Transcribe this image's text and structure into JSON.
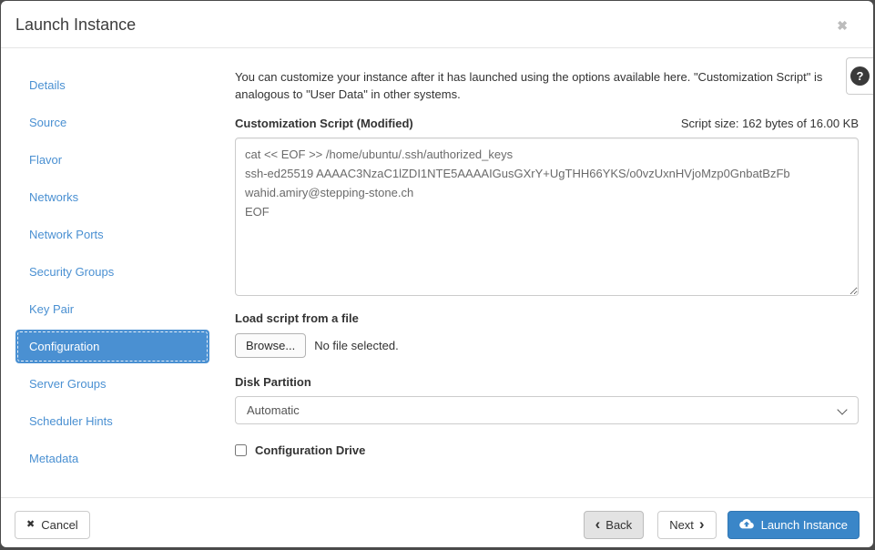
{
  "modal": {
    "title": "Launch Instance"
  },
  "icons": {
    "close": "✖",
    "cancel": "✖",
    "help": "?",
    "back_chevron": "‹",
    "next_chevron": "›"
  },
  "sidebar": {
    "items": [
      {
        "label": "Details",
        "active": false
      },
      {
        "label": "Source",
        "active": false
      },
      {
        "label": "Flavor",
        "active": false
      },
      {
        "label": "Networks",
        "active": false
      },
      {
        "label": "Network Ports",
        "active": false
      },
      {
        "label": "Security Groups",
        "active": false
      },
      {
        "label": "Key Pair",
        "active": false
      },
      {
        "label": "Configuration",
        "active": true
      },
      {
        "label": "Server Groups",
        "active": false
      },
      {
        "label": "Scheduler Hints",
        "active": false
      },
      {
        "label": "Metadata",
        "active": false
      }
    ]
  },
  "content": {
    "description": "You can customize your instance after it has launched using the options available here. \"Customization Script\" is analogous to \"User Data\" in other systems.",
    "script_label": "Customization Script (Modified)",
    "script_size": "Script size: 162 bytes of 16.00 KB",
    "script_value": "cat << EOF >> /home/ubuntu/.ssh/authorized_keys\nssh-ed25519 AAAAC3NzaC1lZDI1NTE5AAAAIGusGXrY+UgTHH66YKS/o0vzUxnHVjoMzp0GnbatBzFb\nwahid.amiry@stepping-stone.ch\nEOF",
    "file_label": "Load script from a file",
    "browse_button": "Browse...",
    "no_file_text": "No file selected.",
    "disk_partition_label": "Disk Partition",
    "disk_partition_value": "Automatic",
    "config_drive_label": "Configuration Drive",
    "config_drive_checked": false
  },
  "footer": {
    "cancel": "Cancel",
    "back": "Back",
    "next": "Next",
    "launch": "Launch Instance"
  },
  "colors": {
    "accent_blue": "#4a90d2",
    "primary_button_blue": "#3a86c8",
    "backdrop": "#4b4b4b"
  }
}
